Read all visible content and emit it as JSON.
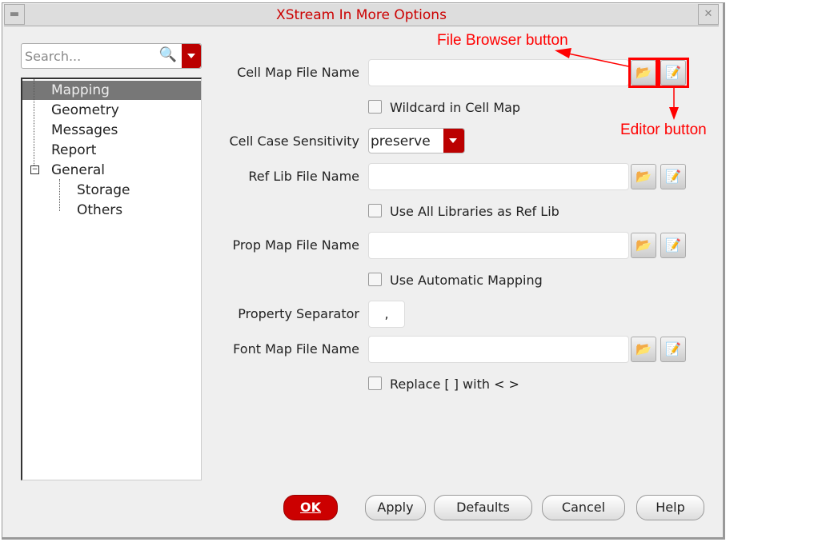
{
  "window": {
    "title": "XStream In More Options"
  },
  "search": {
    "placeholder": "Search..."
  },
  "tree": [
    {
      "label": "Mapping"
    },
    {
      "label": "Geometry"
    },
    {
      "label": "Messages"
    },
    {
      "label": "Report"
    },
    {
      "label": "General"
    },
    {
      "label": "Storage"
    },
    {
      "label": "Others"
    }
  ],
  "form": {
    "cell_map": "Cell Map File Name",
    "wildcard": "Wildcard in Cell Map",
    "case": "Cell Case Sensitivity",
    "case_value": "preserve",
    "ref_lib": "Ref Lib File Name",
    "use_all": "Use All Libraries as Ref Lib",
    "prop_map": "Prop Map File Name",
    "auto_map": "Use Automatic Mapping",
    "prop_sep": "Property Separator",
    "prop_sep_value": ",",
    "font_map": "Font Map File Name",
    "replace": "Replace [ ] with < >"
  },
  "buttons": {
    "ok": "OK",
    "apply": "Apply",
    "defaults": "Defaults",
    "cancel": "Cancel",
    "help": "Help"
  },
  "annotations": {
    "file_browser": "File Browser button",
    "editor": "Editor button"
  }
}
